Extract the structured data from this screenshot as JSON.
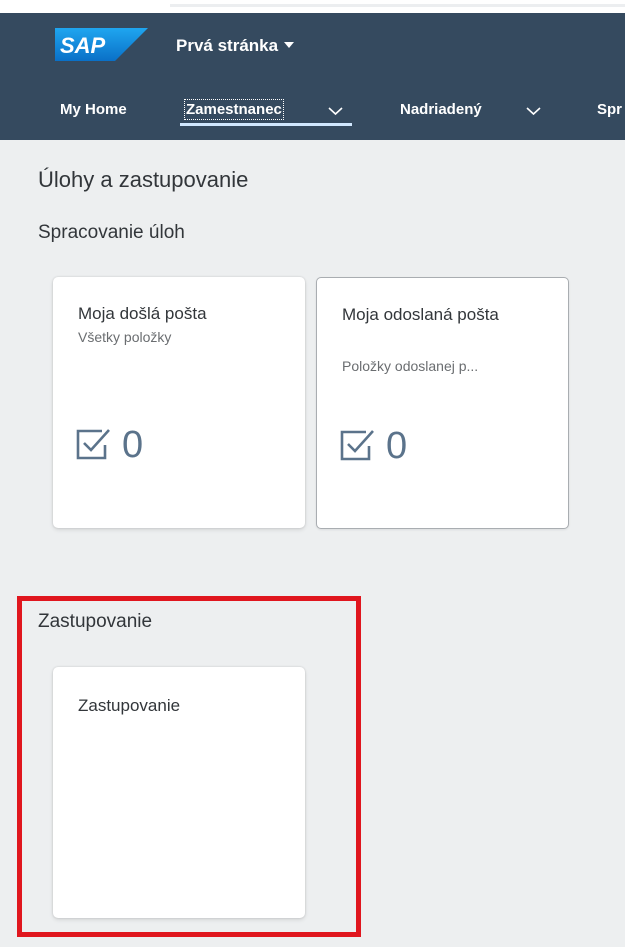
{
  "shell": {
    "logo_text": "SAP",
    "page_title": "Prvá stránka",
    "nav_tabs": [
      {
        "label": "My Home"
      },
      {
        "label": "Zamestnanec"
      },
      {
        "label": "Nadriadený"
      },
      {
        "label": "Spr"
      }
    ],
    "brand_color": "#354a5f"
  },
  "content": {
    "section_title": "Úlohy a zastupovanie",
    "groups": [
      {
        "title": "Spracovanie úloh",
        "tiles": [
          {
            "title": "Moja došlá pošta",
            "subtitle": "Všetky položky",
            "icon": "task-checkbox-icon",
            "value": "0"
          },
          {
            "title": "Moja odoslaná pošta",
            "subtitle": "Položky odoslanej p...",
            "icon": "task-checkbox-icon",
            "value": "0"
          }
        ]
      },
      {
        "title": "Zastupovanie",
        "tiles": [
          {
            "title": "Zastupovanie"
          }
        ]
      }
    ],
    "highlight_color": "#e0161e"
  }
}
